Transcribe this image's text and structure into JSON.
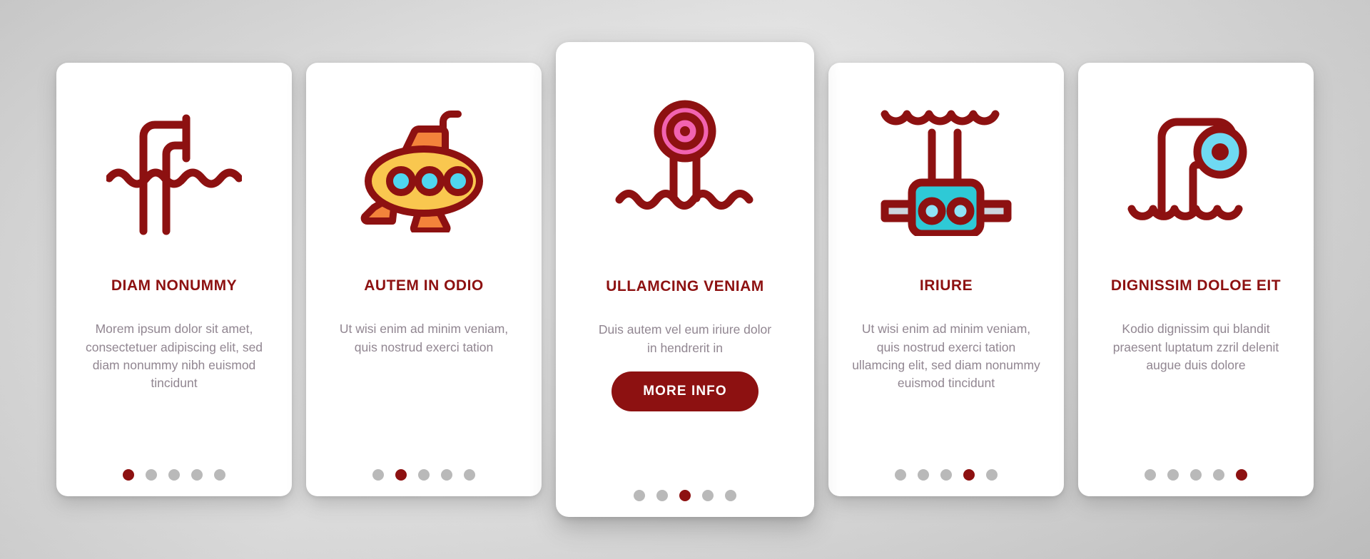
{
  "theme": {
    "accent": "#8d1111",
    "body_text": "#918691",
    "dot_inactive": "#b9b9b9",
    "card_bg": "#ffffff",
    "page_bg": "#d8d8d8",
    "icon_yellow": "#f9c74f",
    "icon_orange": "#f3833b",
    "icon_cyan": "#3ecfe0",
    "icon_light_cyan": "#8fe3f5",
    "icon_pink": "#f263b0",
    "icon_grey": "#ccd5dd"
  },
  "cards": [
    {
      "id": "card-1",
      "icon_name": "periscope-waves-icon",
      "title": "DIAM NONUMMY",
      "body": "Morem ipsum dolor sit amet, consectetuer adipiscing elit, sed diam nonummy nibh euismod tincidunt",
      "featured": false,
      "button": null,
      "dots": {
        "count": 5,
        "active_index": 0
      }
    },
    {
      "id": "card-2",
      "icon_name": "submarine-icon",
      "title": "AUTEM IN ODIO",
      "body": "Ut wisi enim ad minim veniam, quis nostrud exerci tation",
      "featured": false,
      "button": null,
      "dots": {
        "count": 5,
        "active_index": 1
      }
    },
    {
      "id": "card-3",
      "icon_name": "buoy-marker-waves-icon",
      "title": "ULLAMCING VENIAM",
      "body": "Duis autem vel eum iriure dolor in hendrerit in",
      "featured": true,
      "button": "MORE INFO",
      "dots": {
        "count": 5,
        "active_index": 2
      }
    },
    {
      "id": "card-4",
      "icon_name": "underwater-drone-icon",
      "title": "IRIURE",
      "body": "Ut wisi enim ad minim veniam, quis nostrud exerci tation ullamcing elit, sed diam nonummy euismod tincidunt",
      "featured": false,
      "button": null,
      "dots": {
        "count": 5,
        "active_index": 3
      }
    },
    {
      "id": "card-5",
      "icon_name": "periscope-lens-waves-icon",
      "title": "DIGNISSIM DOLOE EIT",
      "body": "Kodio dignissim qui blandit praesent luptatum zzril delenit augue duis dolore",
      "featured": false,
      "button": null,
      "dots": {
        "count": 5,
        "active_index": 4
      }
    }
  ]
}
